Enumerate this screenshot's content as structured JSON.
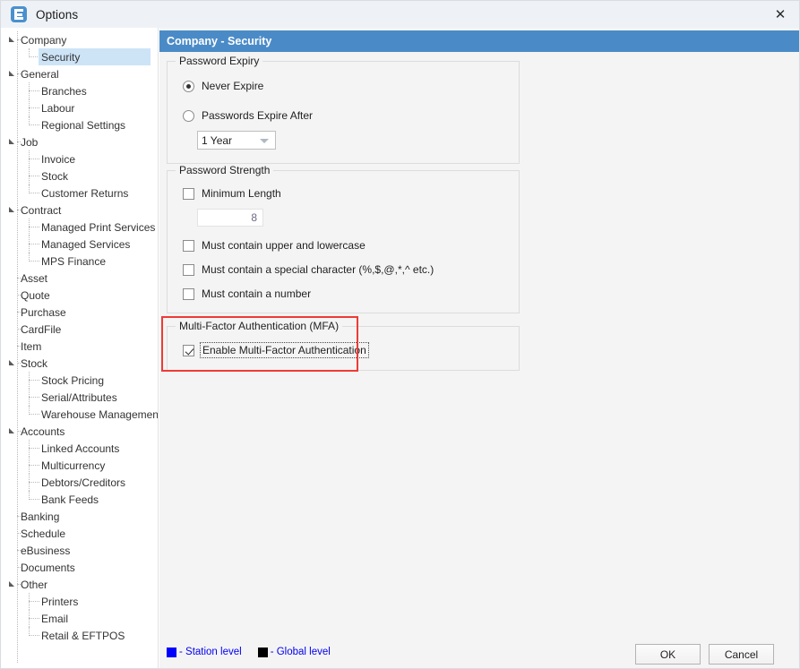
{
  "window": {
    "title": "Options",
    "app_icon": "options-app-icon",
    "close_icon": "✕"
  },
  "sidebar": {
    "items": [
      {
        "label": "Company",
        "level": 0,
        "expandable": true,
        "selected": false
      },
      {
        "label": "Security",
        "level": 1,
        "expandable": false,
        "selected": true
      },
      {
        "label": "General",
        "level": 0,
        "expandable": true,
        "selected": false
      },
      {
        "label": "Branches",
        "level": 1,
        "expandable": false,
        "selected": false
      },
      {
        "label": "Labour",
        "level": 1,
        "expandable": false,
        "selected": false
      },
      {
        "label": "Regional Settings",
        "level": 1,
        "expandable": false,
        "selected": false
      },
      {
        "label": "Job",
        "level": 0,
        "expandable": true,
        "selected": false
      },
      {
        "label": "Invoice",
        "level": 1,
        "expandable": false,
        "selected": false
      },
      {
        "label": "Stock",
        "level": 1,
        "expandable": false,
        "selected": false
      },
      {
        "label": "Customer Returns",
        "level": 1,
        "expandable": false,
        "selected": false
      },
      {
        "label": "Contract",
        "level": 0,
        "expandable": true,
        "selected": false
      },
      {
        "label": "Managed Print Services",
        "level": 1,
        "expandable": false,
        "selected": false
      },
      {
        "label": "Managed Services",
        "level": 1,
        "expandable": false,
        "selected": false
      },
      {
        "label": "MPS Finance",
        "level": 1,
        "expandable": false,
        "selected": false
      },
      {
        "label": "Asset",
        "level": 0,
        "expandable": false,
        "selected": false
      },
      {
        "label": "Quote",
        "level": 0,
        "expandable": false,
        "selected": false
      },
      {
        "label": "Purchase",
        "level": 0,
        "expandable": false,
        "selected": false
      },
      {
        "label": "CardFile",
        "level": 0,
        "expandable": false,
        "selected": false
      },
      {
        "label": "Item",
        "level": 0,
        "expandable": false,
        "selected": false
      },
      {
        "label": "Stock",
        "level": 0,
        "expandable": true,
        "selected": false
      },
      {
        "label": "Stock Pricing",
        "level": 1,
        "expandable": false,
        "selected": false
      },
      {
        "label": "Serial/Attributes",
        "level": 1,
        "expandable": false,
        "selected": false
      },
      {
        "label": "Warehouse Management",
        "level": 1,
        "expandable": false,
        "selected": false
      },
      {
        "label": "Accounts",
        "level": 0,
        "expandable": true,
        "selected": false
      },
      {
        "label": "Linked Accounts",
        "level": 1,
        "expandable": false,
        "selected": false
      },
      {
        "label": "Multicurrency",
        "level": 1,
        "expandable": false,
        "selected": false
      },
      {
        "label": "Debtors/Creditors",
        "level": 1,
        "expandable": false,
        "selected": false
      },
      {
        "label": "Bank Feeds",
        "level": 1,
        "expandable": false,
        "selected": false
      },
      {
        "label": "Banking",
        "level": 0,
        "expandable": false,
        "selected": false
      },
      {
        "label": "Schedule",
        "level": 0,
        "expandable": false,
        "selected": false
      },
      {
        "label": "eBusiness",
        "level": 0,
        "expandable": false,
        "selected": false
      },
      {
        "label": "Documents",
        "level": 0,
        "expandable": false,
        "selected": false
      },
      {
        "label": "Other",
        "level": 0,
        "expandable": true,
        "selected": false
      },
      {
        "label": "Printers",
        "level": 1,
        "expandable": false,
        "selected": false
      },
      {
        "label": "Email",
        "level": 1,
        "expandable": false,
        "selected": false
      },
      {
        "label": "Retail & EFTPOS",
        "level": 1,
        "expandable": false,
        "selected": false
      }
    ]
  },
  "panel": {
    "header": "Company - Security",
    "header_color": "#4a8bc7"
  },
  "password_expiry": {
    "title": "Password Expiry",
    "never_expire": {
      "label": "Never Expire",
      "checked": true
    },
    "expire_after": {
      "label": "Passwords Expire After",
      "checked": false
    },
    "period_select": {
      "value": "1 Year"
    }
  },
  "password_strength": {
    "title": "Password Strength",
    "minimum_length": {
      "label": "Minimum Length",
      "checked": false
    },
    "minimum_length_value": "8",
    "upper_lower": {
      "label": "Must contain upper and lowercase",
      "checked": false
    },
    "special_char": {
      "label": "Must contain a special character (%,$,@,*,^ etc.)",
      "checked": false
    },
    "number": {
      "label": "Must contain a number",
      "checked": false
    }
  },
  "mfa": {
    "title": "Multi-Factor Authentication (MFA)",
    "enable": {
      "label": "Enable Multi-Factor Authentication",
      "checked": true
    },
    "highlight_color": "#ee3b36"
  },
  "footer": {
    "station_level": "- Station level",
    "global_level": "- Global level",
    "station_color": "#0000ff",
    "global_color": "#000000",
    "ok": "OK",
    "cancel": "Cancel"
  }
}
